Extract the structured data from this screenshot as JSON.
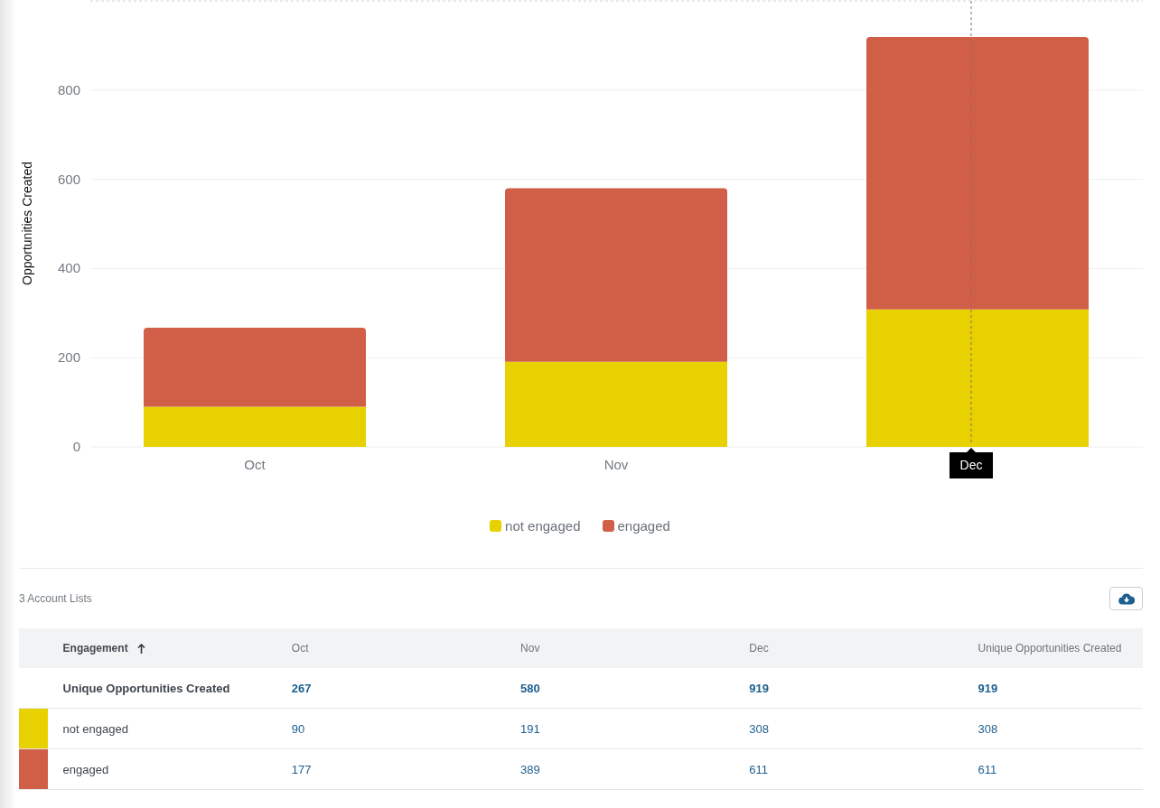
{
  "chart": {
    "chart_data": {
      "type": "bar",
      "ylabel": "Opportunities Created",
      "categories": [
        "Oct",
        "Nov",
        "Dec"
      ],
      "stacked": true,
      "ylim": [
        0,
        1000
      ],
      "yticks": [
        0,
        200,
        400,
        600,
        800
      ],
      "series": [
        {
          "name": "not engaged",
          "color": "#e8d100",
          "values": [
            90,
            191,
            308
          ]
        },
        {
          "name": "engaged",
          "color": "#d15f47",
          "values": [
            177,
            389,
            611
          ]
        }
      ],
      "grid": true,
      "annotations": [
        {
          "x": "Dec"
        }
      ]
    }
  },
  "table": {
    "caption": "3 Account Lists",
    "columns": [
      {
        "label": "Engagement",
        "sorted_ascending": true
      },
      {
        "label": "Oct"
      },
      {
        "label": "Nov"
      },
      {
        "label": "Dec"
      },
      {
        "label": "Unique Opportunities Created"
      }
    ],
    "rows": [
      {
        "kind": "total",
        "cells": [
          "Unique Opportunities Created",
          "267",
          "580",
          "919",
          "919"
        ]
      },
      {
        "kind": "series",
        "color": "#e8d100",
        "cells": [
          "not engaged",
          "90",
          "191",
          "308",
          "308"
        ]
      },
      {
        "kind": "series",
        "color": "#d15f47",
        "cells": [
          "engaged",
          "177",
          "389",
          "611",
          "611"
        ]
      }
    ]
  }
}
